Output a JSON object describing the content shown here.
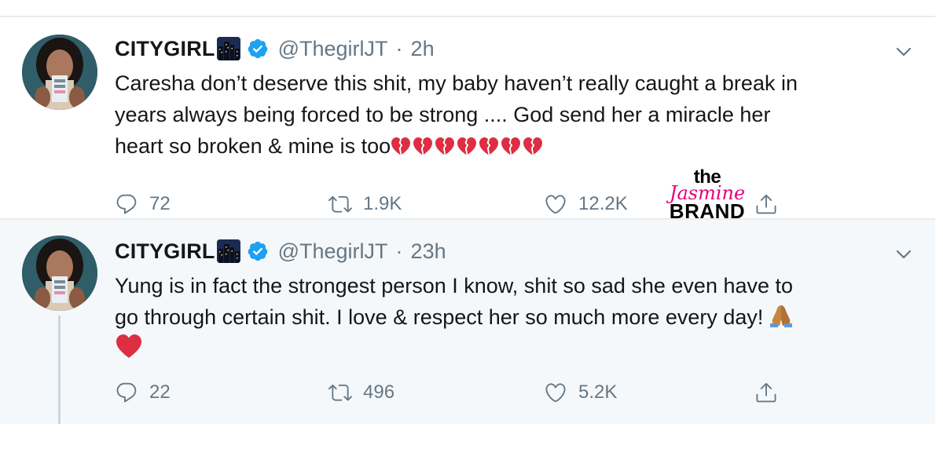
{
  "tweets": [
    {
      "display_name": "CITYGIRL",
      "handle": "@ThegirlJT",
      "separator": "·",
      "time": "2h",
      "text_lines": [
        "Caresha don’t deserve this shit, my baby haven’t really caught a break in",
        "years always being forced to be strong .... God send her a miracle her",
        "heart so broken & mine is too"
      ],
      "trailing_emoji": "broken-heart",
      "trailing_emoji_count": 7,
      "replies": "72",
      "retweets": "1.9K",
      "likes": "12.2K"
    },
    {
      "display_name": "CITYGIRL",
      "handle": "@ThegirlJT",
      "separator": "·",
      "time": "23h",
      "text_lines": [
        "Yung is in fact the strongest person I know, shit so sad she even have to",
        "go through certain shit. I love & respect her so much more every day!"
      ],
      "trailing_emoji": "folded-hands",
      "extra_line_emoji": "red-heart",
      "replies": "22",
      "retweets": "496",
      "likes": "5.2K"
    }
  ],
  "watermark": {
    "line1": "the",
    "line2": "Jasmine",
    "line3": "BRAND"
  },
  "icons": {
    "name_emoji": "night-city-icon",
    "verified": "verified-badge-icon",
    "menu": "chevron-down-icon",
    "reply": "reply-icon",
    "retweet": "retweet-icon",
    "like": "heart-outline-icon",
    "share": "share-icon"
  },
  "colors": {
    "text": "#14171a",
    "secondary": "#657786",
    "verified": "#1da1f2",
    "border": "#e6ecf0",
    "thread_bg": "#f5f8fa",
    "thread_line": "#ccd6dd",
    "heart_red": "#dd2e44",
    "watermark_pink": "#e5007d"
  }
}
